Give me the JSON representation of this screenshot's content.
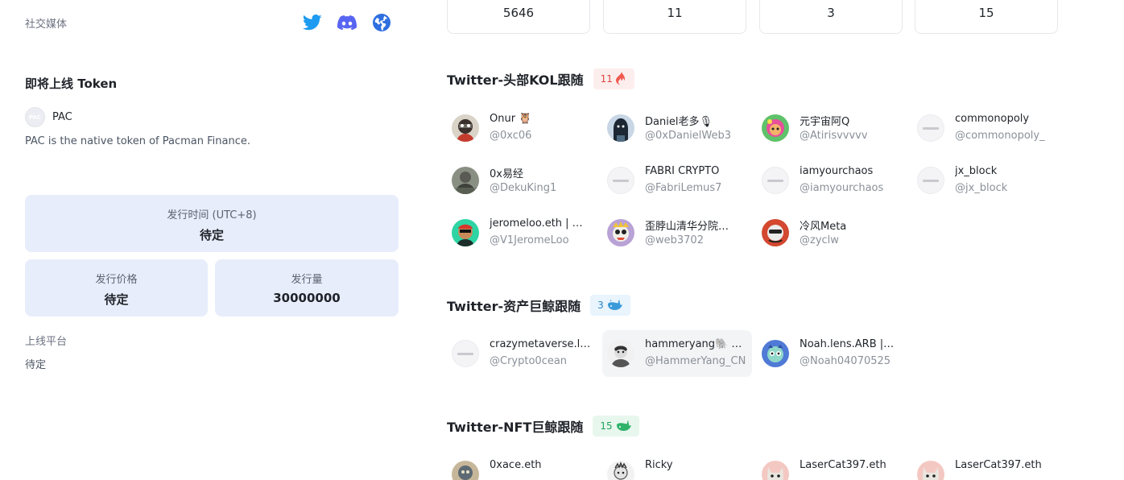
{
  "social": {
    "label": "社交媒体",
    "icons": [
      "twitter-icon",
      "discord-icon",
      "website-globe-icon"
    ],
    "colors": {
      "twitter": "#1d9bf0",
      "discord": "#5865f2",
      "website": "#2f6fe0"
    }
  },
  "upcoming": {
    "title": "即将上线 Token",
    "token_name": "PAC",
    "token_logo_text": "PAC",
    "description": "PAC is the native token of Pacman Finance.",
    "time_label": "发行时间 (UTC+8)",
    "time_value": "待定",
    "price_label": "发行价格",
    "price_value": "待定",
    "supply_label": "发行量",
    "supply_value": "30000000",
    "platform_label": "上线平台",
    "platform_value": "待定"
  },
  "stats": [
    "5646",
    "11",
    "3",
    "15"
  ],
  "sections": {
    "kol": {
      "title": "Twitter-头部KOL跟随",
      "count": "11",
      "badge_icon": "fire-icon",
      "items": [
        {
          "name": "Onur 🦉",
          "handle": "@0xc06",
          "avatar": "avatar-onur"
        },
        {
          "name": "Daniel老多🎙",
          "handle": "@0xDanielWeb3",
          "avatar": "avatar-daniel"
        },
        {
          "name": "元宇宙阿Q",
          "handle": "@Atirisvvvvv",
          "avatar": "avatar-aq"
        },
        {
          "name": "commonopoly",
          "handle": "@commonopoly_",
          "avatar": "avatar-default"
        },
        {
          "name": "0x易经",
          "handle": "@DekuKing1",
          "avatar": "avatar-yijing"
        },
        {
          "name": "FABRI CRYPTO",
          "handle": "@FabriLemus7",
          "avatar": "avatar-default"
        },
        {
          "name": "iamyourchaos",
          "handle": "@iamyourchaos",
          "avatar": "avatar-default"
        },
        {
          "name": "jx_block",
          "handle": "@jx_block",
          "avatar": "avatar-default"
        },
        {
          "name": "jeromeloo.eth | …",
          "handle": "@V1JeromeLoo",
          "avatar": "avatar-jerome"
        },
        {
          "name": "歪脖山清华分院…",
          "handle": "@web3702",
          "avatar": "avatar-web3702"
        },
        {
          "name": "冷风Meta",
          "handle": "@zyclw",
          "avatar": "avatar-zyclw"
        }
      ]
    },
    "whale": {
      "title": "Twitter-资产巨鲸跟随",
      "count": "3",
      "badge_icon": "whale-icon",
      "items": [
        {
          "name": "crazymetaverse.le…",
          "handle": "@Crypto0cean",
          "avatar": "avatar-default"
        },
        {
          "name": "hammeryang🐘 …",
          "handle": "@HammerYang_CN",
          "avatar": "avatar-hammer"
        },
        {
          "name": "Noah.lens.ARB |…",
          "handle": "@Noah04070525",
          "avatar": "avatar-noah"
        }
      ]
    },
    "nft": {
      "title": "Twitter-NFT巨鲸跟随",
      "count": "15",
      "badge_icon": "green-whale-icon",
      "items": [
        {
          "name": "0xace.eth",
          "handle": "",
          "avatar": "avatar-ace"
        },
        {
          "name": "Ricky",
          "handle": "",
          "avatar": "avatar-ricky"
        },
        {
          "name": "LaserCat397.eth",
          "handle": "",
          "avatar": "avatar-lasercat"
        },
        {
          "name": "LaserCat397.eth",
          "handle": "",
          "avatar": "avatar-lasercat"
        }
      ]
    }
  }
}
